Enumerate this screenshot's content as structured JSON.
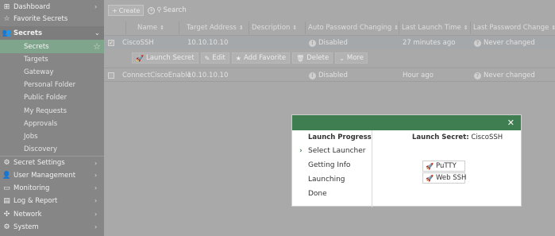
{
  "sidebar": {
    "items": [
      {
        "icon": "globe-icon",
        "glyph": "⊞",
        "label": "Dashboard",
        "type": "top",
        "chevron": "›"
      },
      {
        "icon": "star-icon",
        "glyph": "☆",
        "label": "Favorite Secrets",
        "type": "top",
        "chevron": ""
      },
      {
        "icon": "users-icon",
        "glyph": "👥",
        "label": "Secrets",
        "type": "header-open",
        "chevron": "⌄"
      },
      {
        "icon": "",
        "glyph": "",
        "label": "Secrets",
        "type": "active",
        "chevron": ""
      },
      {
        "icon": "",
        "glyph": "",
        "label": "Targets",
        "type": "sub",
        "chevron": ""
      },
      {
        "icon": "",
        "glyph": "",
        "label": "Gateway",
        "type": "sub",
        "chevron": ""
      },
      {
        "icon": "",
        "glyph": "",
        "label": "Personal Folder",
        "type": "sub",
        "chevron": ""
      },
      {
        "icon": "",
        "glyph": "",
        "label": "Public Folder",
        "type": "sub",
        "chevron": ""
      },
      {
        "icon": "",
        "glyph": "",
        "label": "My Requests",
        "type": "sub",
        "chevron": ""
      },
      {
        "icon": "",
        "glyph": "",
        "label": "Approvals",
        "type": "sub",
        "chevron": ""
      },
      {
        "icon": "",
        "glyph": "",
        "label": "Jobs",
        "type": "sub",
        "chevron": ""
      },
      {
        "icon": "",
        "glyph": "",
        "label": "Discovery",
        "type": "sub",
        "chevron": ""
      },
      {
        "icon": "gear-icon",
        "glyph": "⚙",
        "label": "Secret Settings",
        "type": "top",
        "chevron": "›"
      },
      {
        "icon": "user-icon",
        "glyph": "👤",
        "label": "User Management",
        "type": "top",
        "chevron": "›"
      },
      {
        "icon": "monitor-icon",
        "glyph": "▭",
        "label": "Monitoring",
        "type": "top",
        "chevron": "›"
      },
      {
        "icon": "chart-icon",
        "glyph": "▤",
        "label": "Log & Report",
        "type": "top",
        "chevron": "›"
      },
      {
        "icon": "network-icon",
        "glyph": "✣",
        "label": "Network",
        "type": "top",
        "chevron": "›"
      },
      {
        "icon": "gear-icon",
        "glyph": "⚙",
        "label": "System",
        "type": "top",
        "chevron": "›"
      }
    ]
  },
  "toolbar": {
    "create_label": "Create",
    "search_placeholder": "Search"
  },
  "table": {
    "columns": [
      "Name",
      "Target Address",
      "Description",
      "Auto Password Changing",
      "Last Launch Time",
      "Last Password Change"
    ],
    "rows": [
      {
        "checked": true,
        "name": "CiscoSSH",
        "target": "10.10.10.10",
        "description": "",
        "auto_pw": "Disabled",
        "last_launch": "27 minutes ago",
        "last_pw": "Never changed"
      },
      {
        "checked": false,
        "name": "ConnectCiscoEnable",
        "target": "10.10.10.10",
        "description": "",
        "auto_pw": "Disabled",
        "last_launch": "Hour ago",
        "last_pw": "Never changed"
      }
    ],
    "row_actions": [
      "Launch Secret",
      "Edit",
      "Add Favorite",
      "Delete",
      "More"
    ]
  },
  "modal": {
    "close_glyph": "✕",
    "progress_title": "Launch Progress",
    "steps": [
      "Select Launcher",
      "Getting Info",
      "Launching",
      "Done"
    ],
    "current_step": 0,
    "launch_label": "Launch Secret:",
    "secret_name": "CiscoSSH",
    "launchers": [
      "PuTTY",
      "Web SSH"
    ]
  },
  "colors": {
    "accent": "#3f7e51",
    "active_nav": "#7fa58d"
  }
}
